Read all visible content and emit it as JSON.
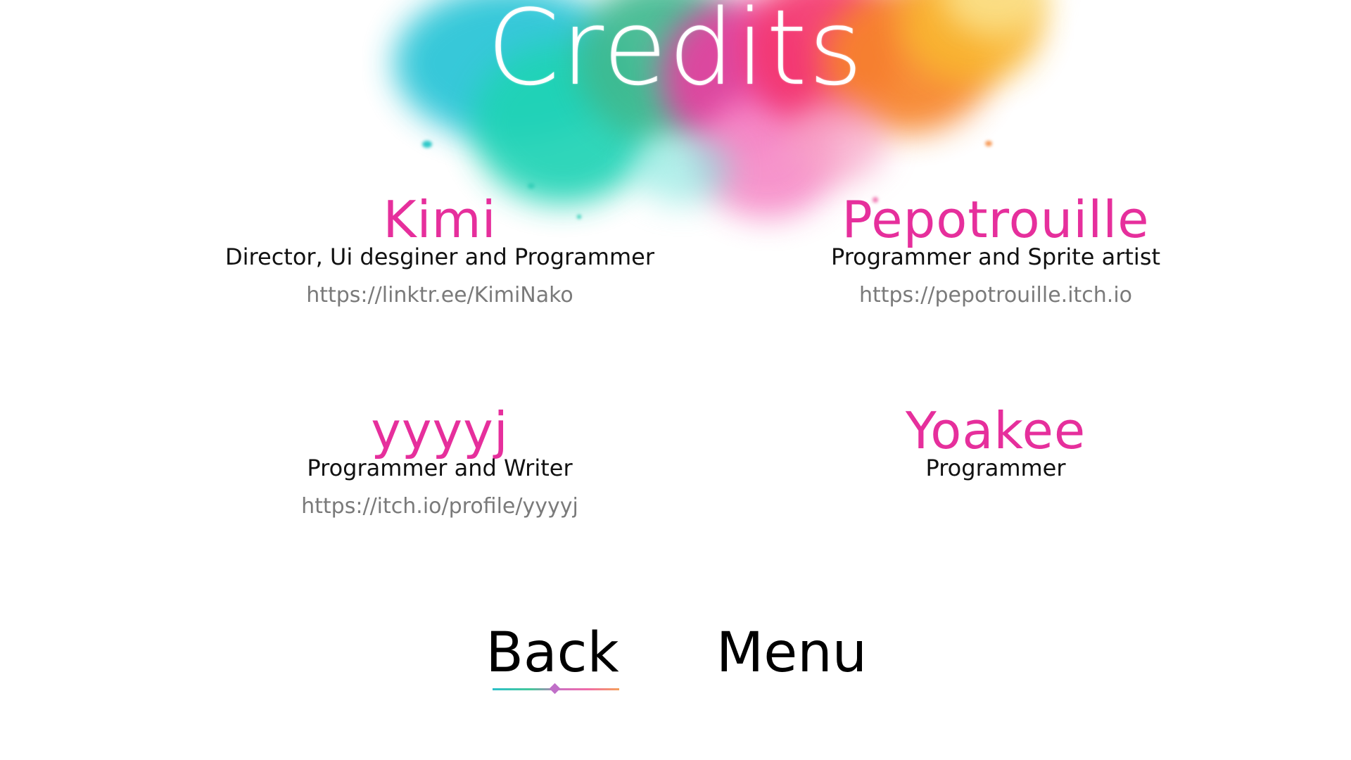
{
  "screen": {
    "title": "Credits"
  },
  "credits": [
    {
      "name": "Kimi",
      "role": "Director, Ui desginer and  Programmer",
      "link": "https://linktr.ee/KimiNako"
    },
    {
      "name": "Pepotrouille",
      "role": "Programmer and Sprite artist",
      "link": "https://pepotrouille.itch.io"
    },
    {
      "name": "yyyyj",
      "role": "Programmer and Writer",
      "link": "https://itch.io/profile/yyyyj"
    },
    {
      "name": "Yoakee",
      "role": "Programmer",
      "link": ""
    }
  ],
  "nav": {
    "back_label": "Back",
    "menu_label": "Menu",
    "selected": "Back"
  },
  "colors": {
    "name": "#e62f9c",
    "role": "#111111",
    "link": "#7a7a7a",
    "title": "#ffffff",
    "button": "#000000"
  }
}
